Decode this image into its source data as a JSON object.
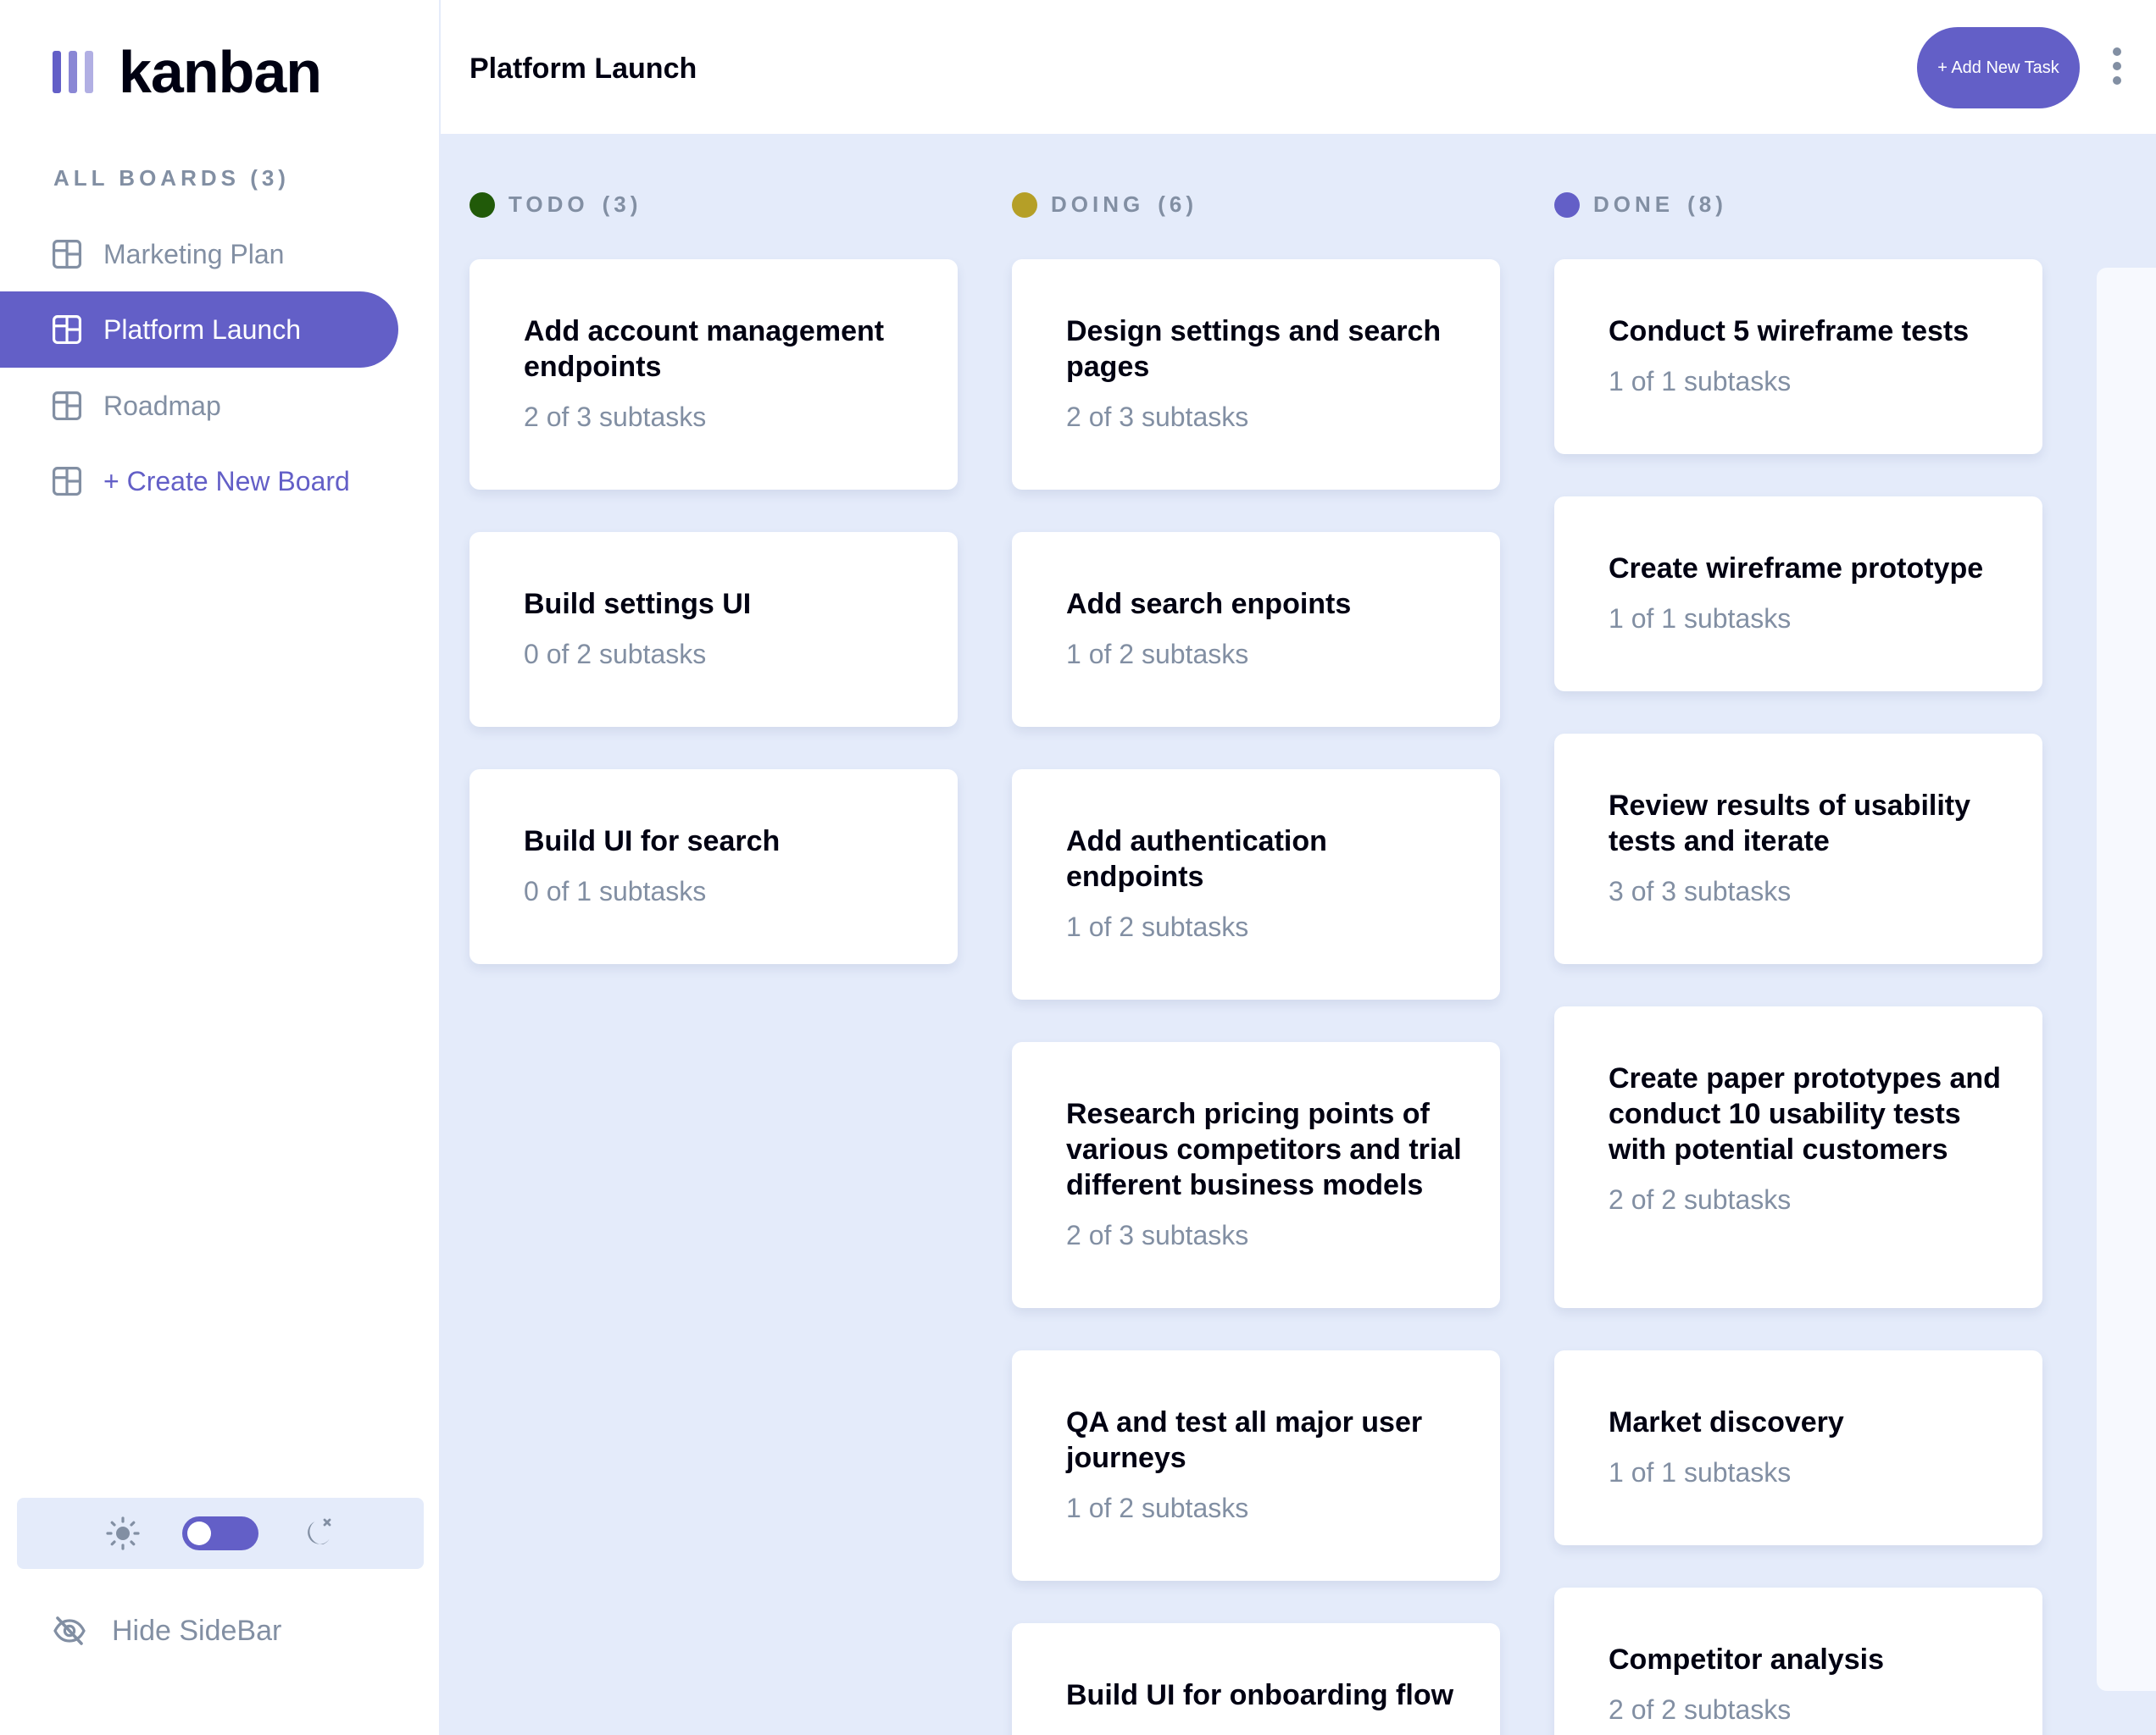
{
  "app": {
    "logo_text": "kanban"
  },
  "colors": {
    "accent": "#635FC7",
    "todo": "#215A09",
    "doing": "#B59F27",
    "done": "#635FC7",
    "board_bg": "#E4EBFA",
    "muted": "#828FA3"
  },
  "sidebar": {
    "heading": "ALL BOARDS (3)",
    "boards": [
      {
        "label": "Marketing Plan",
        "active": false,
        "icon": "board-icon"
      },
      {
        "label": "Platform Launch",
        "active": true,
        "icon": "board-icon"
      },
      {
        "label": "Roadmap",
        "active": false,
        "icon": "board-icon"
      }
    ],
    "create_label": "+ Create New Board",
    "theme": {
      "light_icon": "sun-icon",
      "dark_icon": "moon-icon",
      "mode": "light"
    },
    "hide_label": "Hide SideBar"
  },
  "header": {
    "board_title": "Platform Launch",
    "add_task_label": "+ Add New Task",
    "menu_icon": "kebab-icon"
  },
  "columns": [
    {
      "name": "TODO",
      "count": "(3)",
      "tasks": [
        {
          "title": "Add account management endpoints",
          "subtasks": "2 of 3 subtasks"
        },
        {
          "title": "Build settings UI",
          "subtasks": "0 of 2 subtasks"
        },
        {
          "title": "Build UI for search",
          "subtasks": "0 of 1 subtasks"
        }
      ]
    },
    {
      "name": "DOING",
      "count": "(6)",
      "tasks": [
        {
          "title": "Design settings and search pages",
          "subtasks": "2 of 3 subtasks"
        },
        {
          "title": "Add search enpoints",
          "subtasks": "1 of 2 subtasks"
        },
        {
          "title": "Add authentication endpoints",
          "subtasks": "1 of 2 subtasks"
        },
        {
          "title": "Research pricing points of various competitors and trial different business models",
          "subtasks": "2 of 3 subtasks"
        },
        {
          "title": "QA and test all major user journeys",
          "subtasks": "1 of 2 subtasks"
        },
        {
          "title": "Build UI for onboarding flow",
          "subtasks": ""
        }
      ]
    },
    {
      "name": "DONE",
      "count": "(8)",
      "tasks": [
        {
          "title": "Conduct 5 wireframe tests",
          "subtasks": "1 of 1 subtasks"
        },
        {
          "title": "Create wireframe prototype",
          "subtasks": "1 of 1 subtasks"
        },
        {
          "title": "Review results of usability tests and iterate",
          "subtasks": "3 of 3 subtasks"
        },
        {
          "title": "Create paper prototypes and conduct 10 usability tests with potential customers",
          "subtasks": "2 of 2 subtasks"
        },
        {
          "title": "Market discovery",
          "subtasks": "1 of 1 subtasks"
        },
        {
          "title": "Competitor analysis",
          "subtasks": "2 of 2 subtasks"
        }
      ]
    }
  ]
}
